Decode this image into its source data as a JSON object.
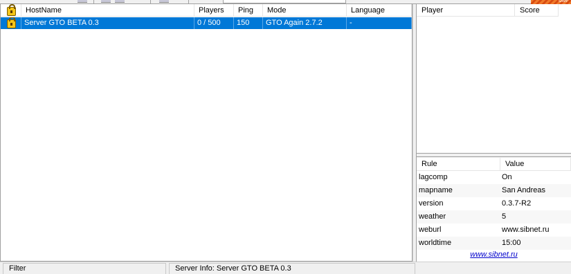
{
  "toolbar": {
    "brand_text": "SAMP"
  },
  "server_list": {
    "columns": [
      "HostName",
      "Players",
      "Ping",
      "Mode",
      "Language"
    ],
    "rows": [
      {
        "hostname": "Server GTO BETA 0.3",
        "players": "0 / 500",
        "ping": "150",
        "mode": "GTO Again 2.7.2",
        "language": "-"
      }
    ]
  },
  "players_panel": {
    "columns": [
      "Player",
      "Score"
    ]
  },
  "rules_panel": {
    "columns": [
      "Rule",
      "Value"
    ],
    "rows": [
      {
        "rule": "lagcomp",
        "value": "On"
      },
      {
        "rule": "mapname",
        "value": "San Andreas"
      },
      {
        "rule": "version",
        "value": "0.3.7-R2"
      },
      {
        "rule": "weather",
        "value": "5"
      },
      {
        "rule": "weburl",
        "value": "www.sibnet.ru"
      },
      {
        "rule": "worldtime",
        "value": "15:00"
      }
    ],
    "link_text": "www.sibnet.ru"
  },
  "status_bar": {
    "filter_label": "Filter",
    "server_info": "Server Info: Server GTO BETA 0.3"
  },
  "colors": {
    "selection": "#0078d7",
    "link": "#0000cc"
  }
}
